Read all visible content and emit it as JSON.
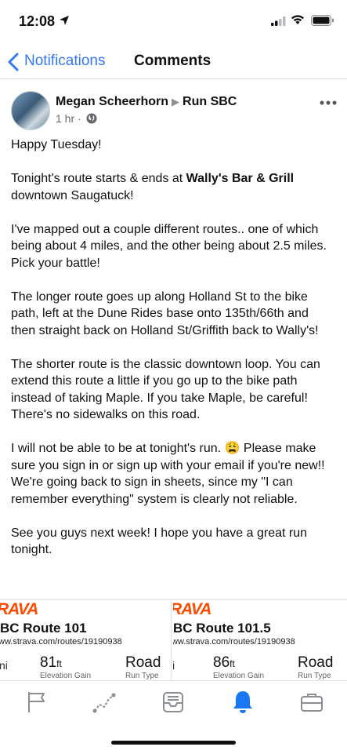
{
  "status_bar": {
    "time": "12:08"
  },
  "nav": {
    "back_label": "Notifications",
    "title": "Comments"
  },
  "post": {
    "author": "Megan Scheerhorn",
    "group": "Run SBC",
    "time_ago": "1 hr ·",
    "paragraphs": {
      "p1": "Happy Tuesday!",
      "p2_before": "Tonight's route starts & ends at ",
      "p2_bold": "Wally's Bar & Grill",
      "p2_after": " downtown Saugatuck!",
      "p3": "I've mapped out a couple different routes.. one of which being about 4 miles, and the other being about 2.5 miles. Pick your battle!",
      "p4": "The longer route goes up along Holland St to the bike path, left at the Dune Rides base onto 135th/66th and then straight back on Holland St/Griffith back to Wally's!",
      "p5": "The shorter route is the classic downtown loop. You can extend this route a little if you go up to the bike path instead of taking Maple. If you take Maple, be careful! There's no sidewalks on this road.",
      "p6_before": "I will not be able to be at tonight's run. ",
      "p6_emoji": "😩",
      "p6_after": " Please make sure you sign in or sign up with your email if you're new!! We're going back to sign in sheets, since my \"I can remember everything\" system is clearly not reliable.",
      "p7": "See you guys next week! I hope you have a great run tonight."
    }
  },
  "cards": [
    {
      "brand": "RAVA",
      "route_name": "BC Route 101",
      "url": "ww.strava.com/routes/19190938",
      "frag": "ni",
      "elevation_value": "81",
      "elevation_unit": "ft",
      "elevation_label": "Elevation Gain",
      "run_type": "Road",
      "run_type_label": "Run Type"
    },
    {
      "brand": "RAVA",
      "route_name": "BC Route 101.5",
      "url": "ww.strava.com/routes/19190938",
      "frag": "i",
      "elevation_value": "86",
      "elevation_unit": "ft",
      "elevation_label": "Elevation Gain",
      "run_type": "Road",
      "run_type_label": "Run Type"
    }
  ],
  "tabbar": {
    "tabs": [
      {
        "icon": "flag-icon",
        "active": false
      },
      {
        "icon": "route-icon",
        "active": false
      },
      {
        "icon": "inbox-icon",
        "active": false
      },
      {
        "icon": "bell-icon",
        "active": true
      },
      {
        "icon": "briefcase-icon",
        "active": false
      }
    ]
  },
  "colors": {
    "accent": "#3478f6",
    "strava": "#fc4c02",
    "inactive_icon": "#8a8d91"
  }
}
